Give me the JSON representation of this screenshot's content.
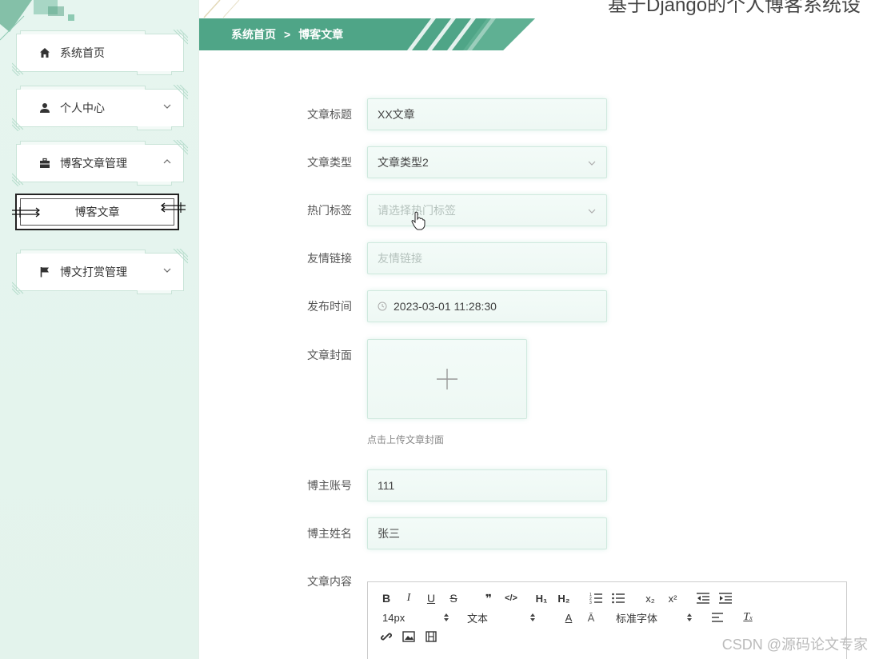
{
  "header": {
    "title_partial": "基于Django的个人博客系统设"
  },
  "sidebar": {
    "items": [
      {
        "label": "系统首页",
        "icon": "home-icon"
      },
      {
        "label": "个人中心",
        "icon": "user-icon",
        "chevron": "down"
      },
      {
        "label": "博客文章管理",
        "icon": "briefcase-icon",
        "chevron": "up"
      },
      {
        "label": "博文打赏管理",
        "icon": "flag-icon",
        "chevron": "down"
      }
    ],
    "sub_item": "博客文章"
  },
  "breadcrumb": {
    "home": "系统首页",
    "separator": ">",
    "current": "博客文章"
  },
  "form": {
    "title": {
      "label": "文章标题",
      "value": "XX文章"
    },
    "type": {
      "label": "文章类型",
      "value": "文章类型2"
    },
    "tags": {
      "label": "热门标签",
      "placeholder": "请选择热门标签"
    },
    "links": {
      "label": "友情链接",
      "placeholder": "友情链接"
    },
    "publish_time": {
      "label": "发布时间",
      "value": "2023-03-01 11:28:30"
    },
    "cover": {
      "label": "文章封面",
      "hint": "点击上传文章封面"
    },
    "account": {
      "label": "博主账号",
      "value": "111"
    },
    "name": {
      "label": "博主姓名",
      "value": "张三"
    },
    "content": {
      "label": "文章内容"
    }
  },
  "editor": {
    "font_size": "14px",
    "heading": "文本",
    "font_family": "标准字体"
  },
  "watermark": "CSDN @源码论文专家",
  "colors": {
    "accent": "#4fa587",
    "sidebar_bg": "#e4f4ed",
    "field_bg": "#f1faf6",
    "field_border": "#cfe9de"
  }
}
